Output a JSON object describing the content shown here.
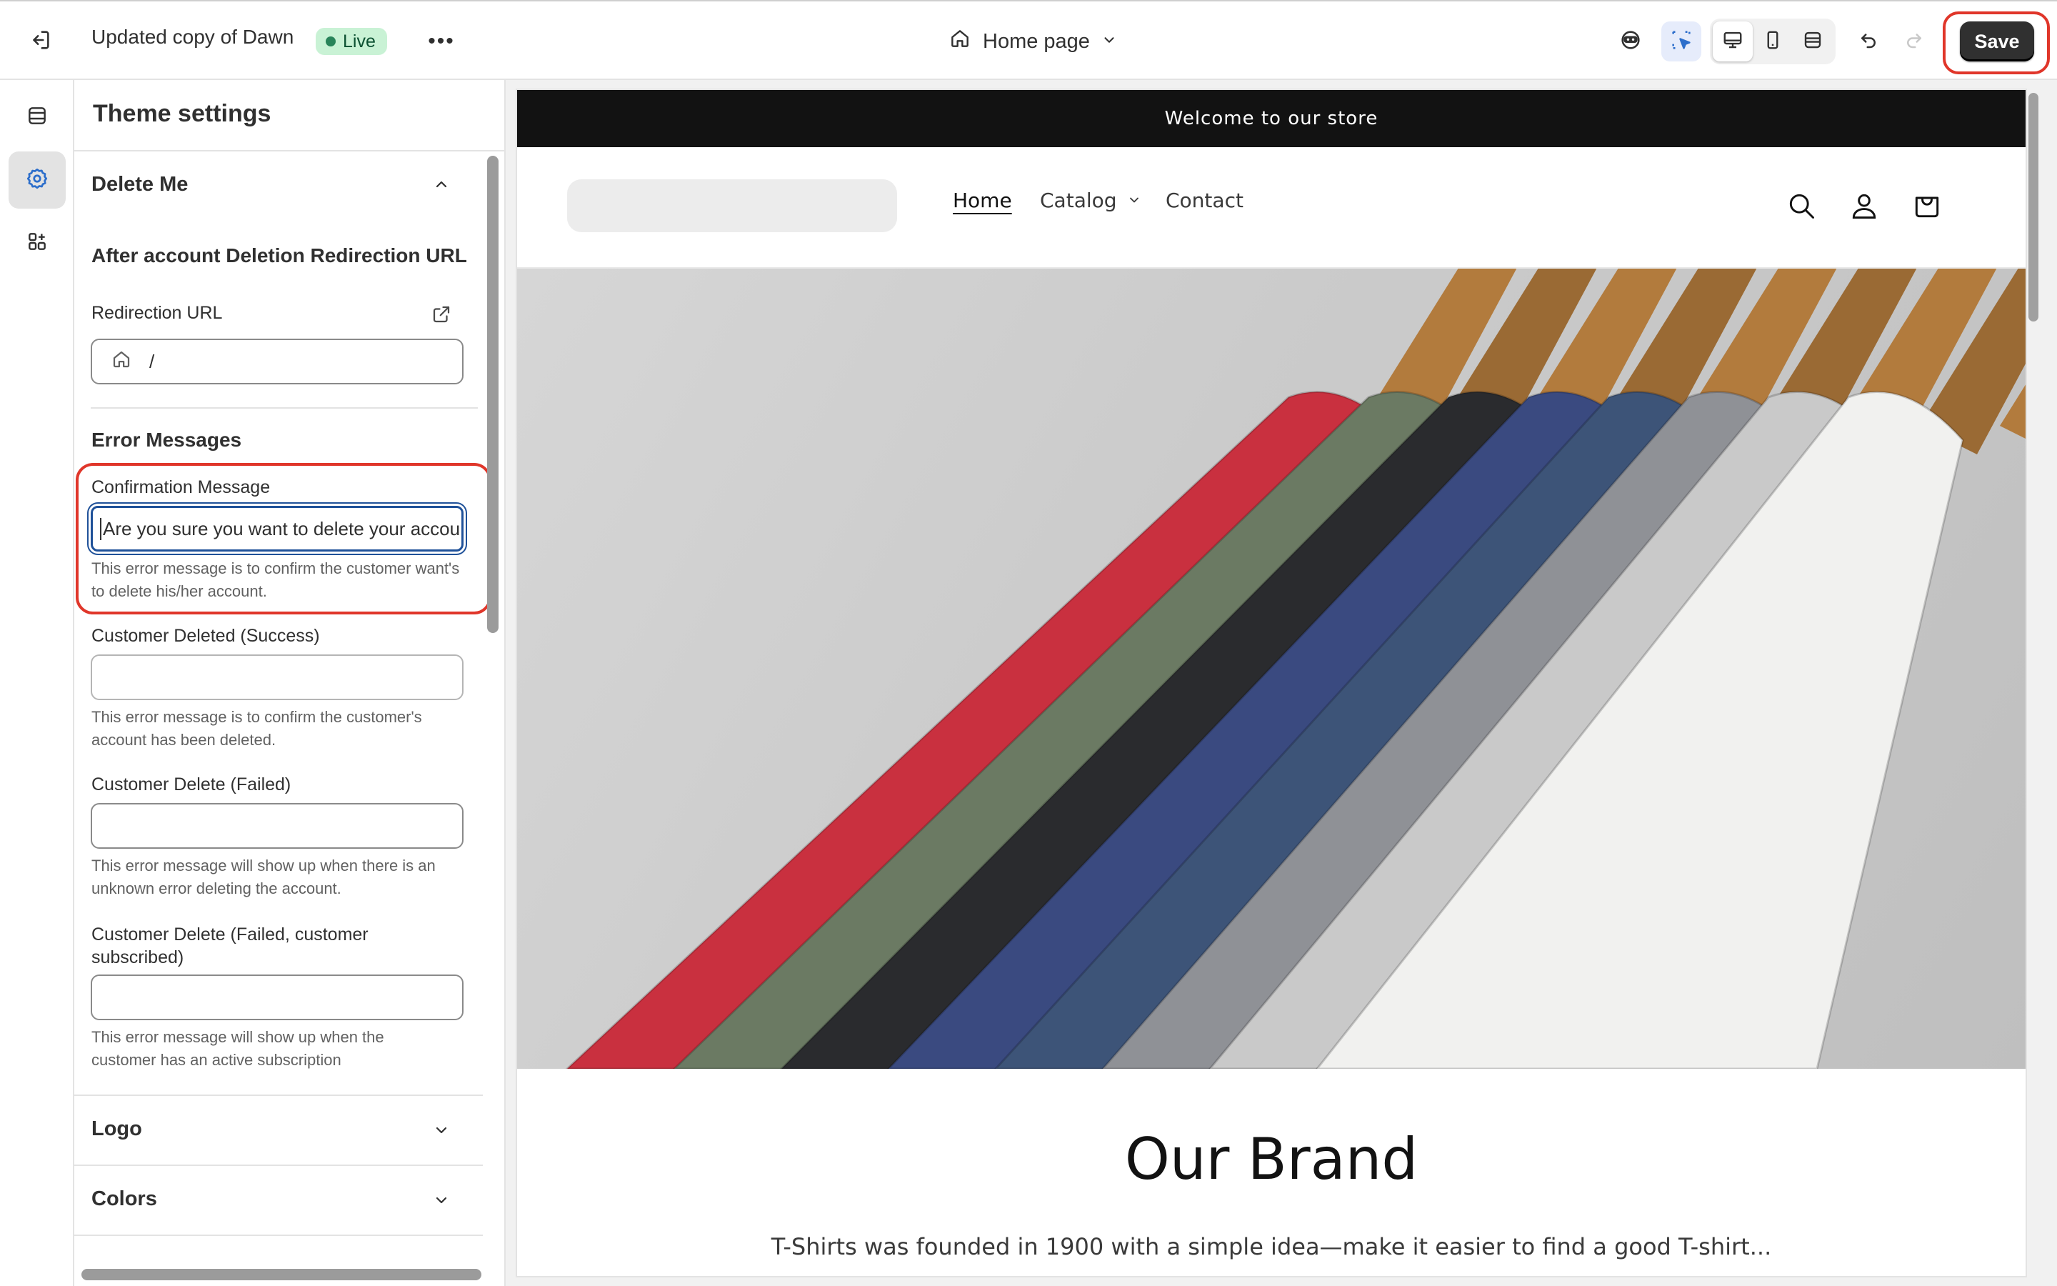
{
  "topbar": {
    "theme_name": "Updated copy of Dawn",
    "status_badge": "Live",
    "more_label": "•••",
    "page_selector": "Home page",
    "save_label": "Save"
  },
  "rail": {
    "items": [
      "sections",
      "theme-settings",
      "app-embeds"
    ],
    "active": "theme-settings"
  },
  "panel": {
    "title": "Theme settings",
    "delete_me": {
      "heading": "Delete Me",
      "redirect_heading": "After account Deletion Redirection URL",
      "redirect_label": "Redirection URL",
      "redirect_value": "/",
      "error_heading": "Error Messages",
      "fields": [
        {
          "label": "Confirmation Message",
          "value": "Are you sure you want to delete your accou",
          "help": "This error message is to confirm the customer want's to delete his/her account."
        },
        {
          "label": "Customer Deleted (Success)",
          "value": "",
          "help": "This error message is to confirm the customer's account has been deleted."
        },
        {
          "label": "Customer Delete (Failed)",
          "value": "",
          "help": "This error message will show up when there is an unknown error deleting the account."
        },
        {
          "label": "Customer Delete (Failed, customer subscribed)",
          "value": "",
          "help": "This error message will show up when the customer has an active subscription"
        }
      ]
    },
    "collapsed_sections": [
      "Logo",
      "Colors"
    ]
  },
  "preview": {
    "announcement": "Welcome to our store",
    "nav": [
      "Home",
      "Catalog",
      "Contact"
    ],
    "brand_title": "Our Brand",
    "brand_text": "T-Shirts was founded in 1900 with a simple idea—make it easier to find a good T-shirt...",
    "shirt_colors": [
      "#c9303f",
      "#6b7a63",
      "#2a2b2e",
      "#3a4a80",
      "#3d5478",
      "#8f9196",
      "#c9c9c9",
      "#f1f1ef"
    ]
  },
  "colors": {
    "accent_red": "#e0362a",
    "focus_blue": "#1f5199",
    "live_green": "#29845a"
  }
}
